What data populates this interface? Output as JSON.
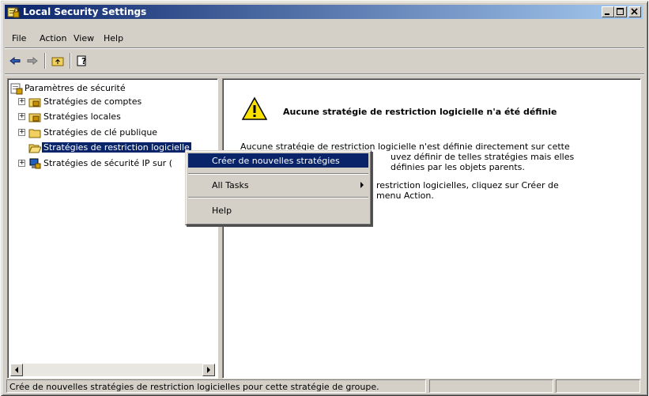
{
  "window": {
    "title": "Local Security Settings"
  },
  "menu": {
    "file": "File",
    "action": "Action",
    "view": "View",
    "help": "Help"
  },
  "toolbar": {
    "icons": [
      "back-arrow-icon",
      "forward-arrow-icon",
      "up-folder-icon",
      "help-icon"
    ]
  },
  "tree": {
    "root": "Paramètres de sécurité",
    "items": [
      {
        "label": "Stratégies de comptes",
        "expander": "+"
      },
      {
        "label": "Stratégies locales",
        "expander": "+"
      },
      {
        "label": "Stratégies de clé publique",
        "expander": "+"
      },
      {
        "label": "Stratégies de restriction logicielle",
        "expander": ""
      },
      {
        "label": "Stratégies de sécurité IP sur (",
        "expander": "+"
      }
    ]
  },
  "content": {
    "heading": "Aucune stratégie de restriction logicielle n'a été définie",
    "para1_line1": "Aucune stratégie de restriction logicielle n'est définie directement sur cette",
    "para1_line2": "uvez définir de telles stratégies mais elles",
    "para1_line3": "définies par les objets parents.",
    "para2_line1": "restriction logicielles, cliquez sur Créer de",
    "para2_line2": "menu Action."
  },
  "context_menu": {
    "create": "Créer de nouvelles stratégies",
    "all_tasks": "All Tasks",
    "help": "Help"
  },
  "status": {
    "text": "Crée de nouvelles stratégies de restriction logicielles pour cette stratégie de groupe."
  },
  "colors": {
    "title_start": "#0a246a",
    "title_end": "#a6caf0",
    "selection": "#0a246a",
    "chrome": "#d4d0c8"
  }
}
